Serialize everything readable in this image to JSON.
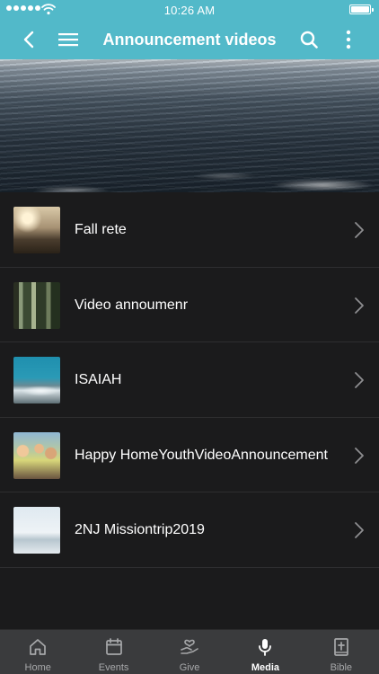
{
  "status_bar": {
    "time": "10:26 AM",
    "signal_dots": 5,
    "icons": [
      "signal-dots-icon",
      "wifi-icon",
      "battery-icon"
    ]
  },
  "nav": {
    "title": "Announcement videos",
    "icons": [
      "back-chevron-icon",
      "hamburger-menu-icon",
      "search-icon",
      "more-vertical-icon"
    ]
  },
  "list": {
    "items": [
      {
        "label": "Fall rete"
      },
      {
        "label": "Video annoumenr"
      },
      {
        "label": "ISAIAH"
      },
      {
        "label": "Happy HomeYouthVideoAnnouncement"
      },
      {
        "label": "2NJ Missiontrip2019"
      }
    ]
  },
  "tabs": {
    "items": [
      {
        "label": "Home",
        "icon": "home-icon",
        "active": false
      },
      {
        "label": "Events",
        "icon": "calendar-icon",
        "active": false
      },
      {
        "label": "Give",
        "icon": "give-heart-hand-icon",
        "active": false
      },
      {
        "label": "Media",
        "icon": "microphone-icon",
        "active": true
      },
      {
        "label": "Bible",
        "icon": "bible-book-icon",
        "active": false
      }
    ]
  },
  "colors": {
    "accent": "#52b9c9",
    "background": "#1b1b1c",
    "tab_bar": "#3a3b3d",
    "divider": "#2e2e30",
    "tab_inactive": "#a7a8aa",
    "tab_active": "#ffffff"
  }
}
